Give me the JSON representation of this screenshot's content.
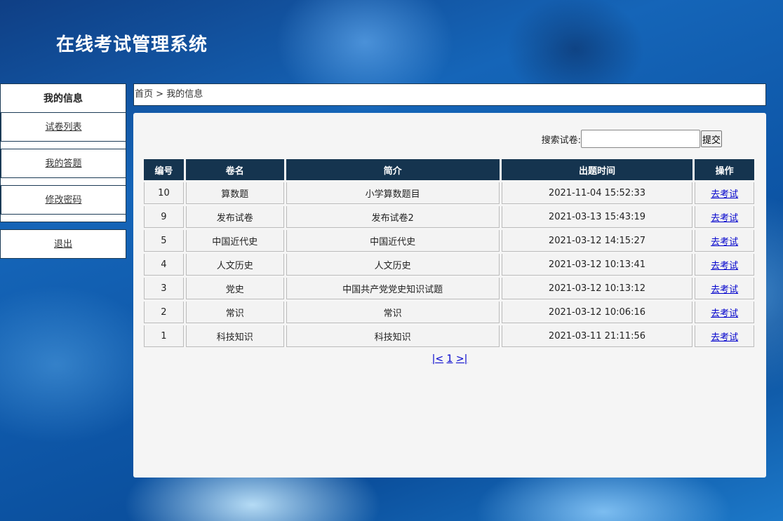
{
  "app": {
    "title": "在线考试管理系统"
  },
  "sidebar": {
    "heading": "我的信息",
    "items": [
      {
        "label": "试卷列表"
      },
      {
        "label": "我的答题"
      },
      {
        "label": "修改密码"
      }
    ],
    "logout": "退出"
  },
  "breadcrumb": {
    "home": "首页",
    "separator": " > ",
    "current": "我的信息"
  },
  "search": {
    "label": "搜索试卷:",
    "value": "",
    "submit": "提交"
  },
  "table": {
    "headers": [
      "编号",
      "卷名",
      "简介",
      "出题时间",
      "操作"
    ],
    "rows": [
      {
        "id": "10",
        "name": "算数题",
        "intro": "小学算数题目",
        "time": "2021-11-04 15:52:33",
        "action": "去考试"
      },
      {
        "id": "9",
        "name": "发布试卷",
        "intro": "发布试卷2",
        "time": "2021-03-13 15:43:19",
        "action": "去考试"
      },
      {
        "id": "5",
        "name": "中国近代史",
        "intro": "中国近代史",
        "time": "2021-03-12 14:15:27",
        "action": "去考试"
      },
      {
        "id": "4",
        "name": "人文历史",
        "intro": "人文历史",
        "time": "2021-03-12 10:13:41",
        "action": "去考试"
      },
      {
        "id": "3",
        "name": "党史",
        "intro": "中国共产党党史知识试题",
        "time": "2021-03-12 10:13:12",
        "action": "去考试"
      },
      {
        "id": "2",
        "name": "常识",
        "intro": "常识",
        "time": "2021-03-12 10:06:16",
        "action": "去考试"
      },
      {
        "id": "1",
        "name": "科技知识",
        "intro": "科技知识",
        "time": "2021-03-11 21:11:56",
        "action": "去考试"
      }
    ]
  },
  "pager": {
    "open": "|",
    "prev": "<",
    "page": "1",
    "next": ">",
    "close": "|"
  },
  "colors": {
    "header_bg": "#15344f",
    "link": "#0000cc",
    "panel_bg": "#f5f5f5"
  }
}
